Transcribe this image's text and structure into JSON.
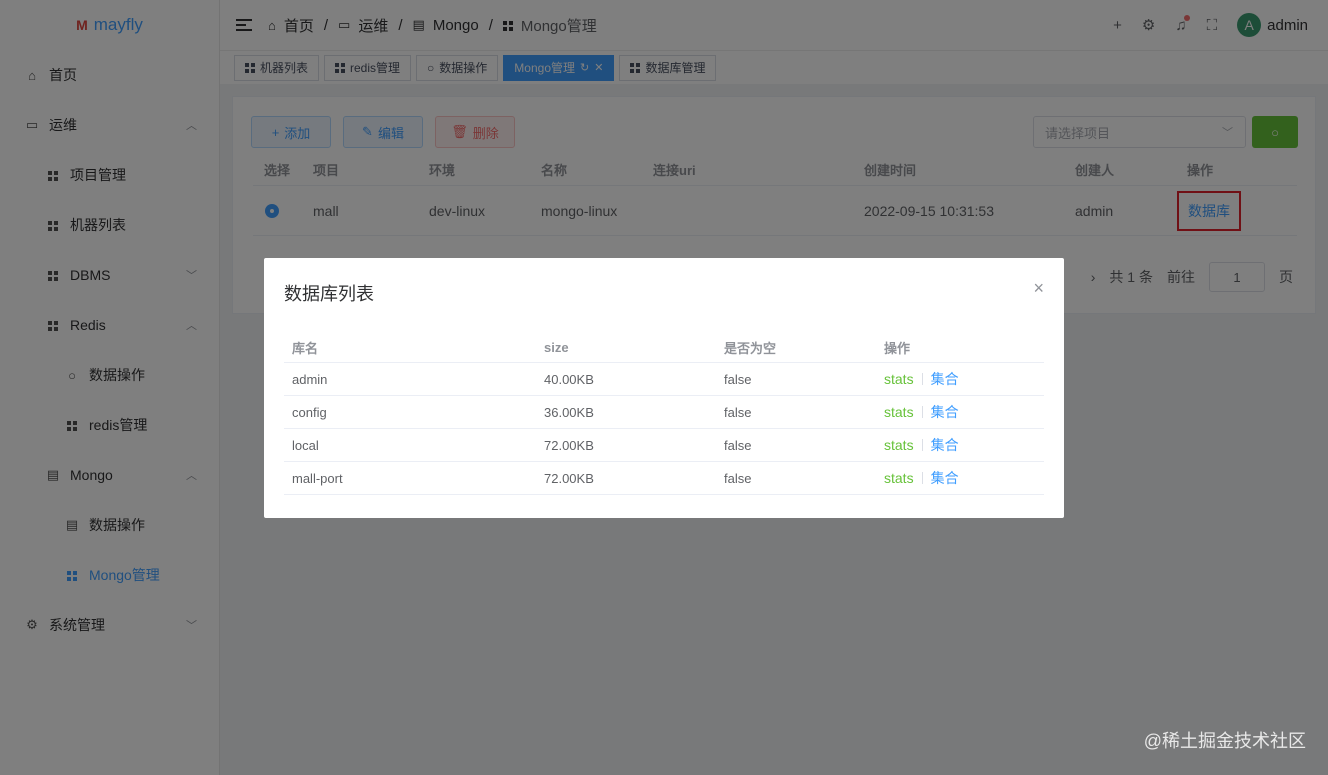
{
  "sidebar": {
    "logo": "mayfly",
    "items": [
      {
        "label": "首页"
      },
      {
        "label": "运维"
      },
      {
        "label": "项目管理"
      },
      {
        "label": "机器列表"
      },
      {
        "label": "DBMS"
      },
      {
        "label": "Redis"
      },
      {
        "label": "数据操作"
      },
      {
        "label": "redis管理"
      },
      {
        "label": "Mongo"
      },
      {
        "label": "数据操作"
      },
      {
        "label": "Mongo管理"
      },
      {
        "label": "系统管理"
      }
    ]
  },
  "header": {
    "breadcrumb": [
      "首页",
      "运维",
      "Mongo",
      "Mongo管理"
    ],
    "user": "admin",
    "avatar_letter": "A"
  },
  "tags": [
    "机器列表",
    "redis管理",
    "数据操作",
    "Mongo管理",
    "数据库管理"
  ],
  "toolbar": {
    "add_label": "添加",
    "edit_label": "编辑",
    "delete_label": "删除",
    "select_placeholder": "请选择项目"
  },
  "table": {
    "headers": [
      "选择",
      "项目",
      "环境",
      "名称",
      "连接uri",
      "创建时间",
      "创建人",
      "操作"
    ],
    "rows": [
      {
        "project": "mall",
        "env": "dev-linux",
        "name": "mongo-linux",
        "uri": "",
        "created": "2022-09-15 10:31:53",
        "creator": "admin",
        "action": "数据库"
      }
    ]
  },
  "pager": {
    "total": "共 1 条",
    "goto": "前往",
    "page": "1",
    "page_unit": "页"
  },
  "dialog": {
    "title": "数据库列表",
    "headers": [
      "库名",
      "size",
      "是否为空",
      "操作"
    ],
    "rows": [
      {
        "name": "admin",
        "size": "40.00KB",
        "empty": "false",
        "stats": "stats",
        "coll": "集合"
      },
      {
        "name": "config",
        "size": "36.00KB",
        "empty": "false",
        "stats": "stats",
        "coll": "集合"
      },
      {
        "name": "local",
        "size": "72.00KB",
        "empty": "false",
        "stats": "stats",
        "coll": "集合"
      },
      {
        "name": "mall-port",
        "size": "72.00KB",
        "empty": "false",
        "stats": "stats",
        "coll": "集合"
      }
    ]
  },
  "watermark": "@稀土掘金技术社区",
  "colors": {
    "primary": "#409eff",
    "success": "#67c23a",
    "danger": "#f56c6c",
    "highlight_border": "#e0202a"
  }
}
